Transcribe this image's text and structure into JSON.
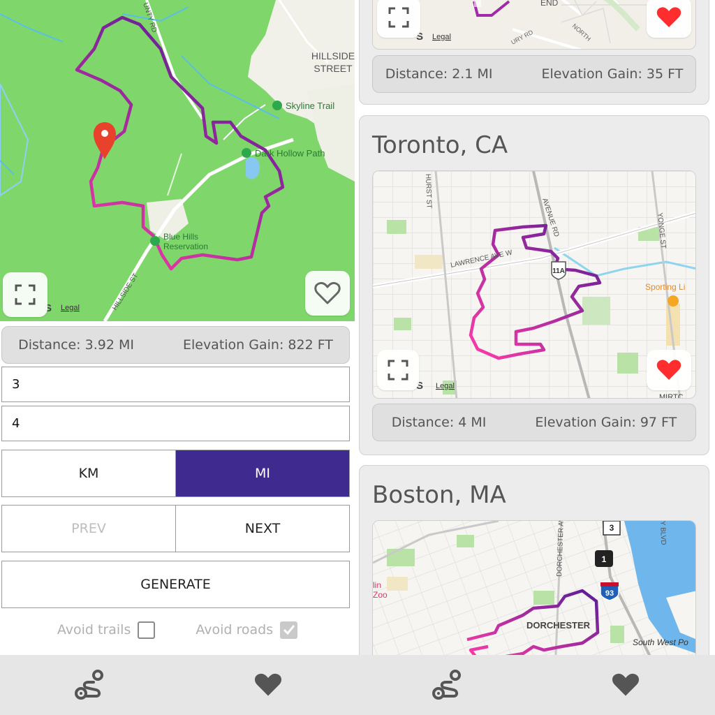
{
  "main_route": {
    "map_labels": {
      "hillside_street": "HILLSIDE\nSTREET",
      "hillside_line1": "HILLSIDE",
      "hillside_line2": "STREET",
      "skyline_trail": "Skyline Trail",
      "dark_hollow_path": "Dark Hollow Path",
      "blue_hills_line1": "Blue Hills",
      "blue_hills_line2": "Reservation",
      "hillside_st": "HILLSIDE ST",
      "county_rd": "UNTY RD",
      "legal": "Legal",
      "maps_partial": "S"
    },
    "distance": "Distance: 3.92 MI",
    "elevation": "Elevation Gain: 822 FT",
    "favorited": false
  },
  "form": {
    "field1_value": "3",
    "field2_value": "4",
    "unit_km": "KM",
    "unit_mi": "MI",
    "active_unit": "MI",
    "prev_label": "PREV",
    "next_label": "NEXT",
    "generate_label": "GENERATE",
    "avoid_trails_label": "Avoid trails",
    "avoid_trails_checked": false,
    "avoid_roads_label": "Avoid roads",
    "avoid_roads_checked": true
  },
  "saved_routes": [
    {
      "title": "",
      "map_labels": {
        "end": "END",
        "legal": "Legal",
        "maps_partial": "S",
        "road1": "URY RD",
        "road2": "NORTH"
      },
      "distance": "Distance: 2.1 MI",
      "elevation": "Elevation Gain: 35 FT",
      "favorited": true
    },
    {
      "title": "Toronto, CA",
      "map_labels": {
        "hurst_st": "HURST ST",
        "lawrence": "LAWRENCE AVE W",
        "avenue_rd": "AVENUE RD",
        "yonge": "YONGE ST",
        "sporting": "Sporting Li",
        "shield": "11A",
        "legal": "Legal",
        "maps_partial": "S",
        "corner": "MIRTC"
      },
      "distance": "Distance: 4 MI",
      "elevation": "Elevation Gain: 97 FT",
      "favorited": true
    },
    {
      "title": "Boston, MA",
      "map_labels": {
        "dorchester_ave": "DORCHESTER AV",
        "dorchester": "DORCHESTER",
        "south_west": "South West Po",
        "zoo1": "lin",
        "zoo2": "Zoo",
        "shield3": "3",
        "shield1": "1",
        "shield93": "93",
        "blvd": "Y BLVD"
      }
    }
  ],
  "nav": {
    "items": [
      "routes-icon",
      "heart-icon",
      "routes-icon",
      "heart-icon"
    ]
  },
  "colors": {
    "accent": "#3f2a8f",
    "route_start": "#ff3ba8",
    "route_end": "#5a1d96",
    "favorite": "#ff2d2d"
  }
}
